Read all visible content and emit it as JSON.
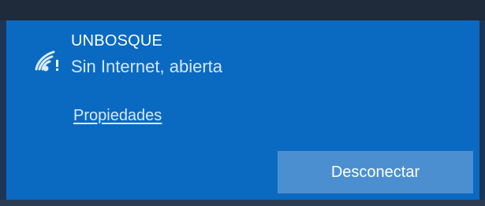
{
  "network": {
    "name": "UNBOSQUE",
    "status": "Sin Internet, abierta",
    "icon": "wifi-warning-icon"
  },
  "links": {
    "properties": "Propiedades"
  },
  "actions": {
    "disconnect": "Desconectar"
  },
  "colors": {
    "panel": "#0a6ac2",
    "button": "#4b8fd0",
    "text": "#ffffff"
  }
}
